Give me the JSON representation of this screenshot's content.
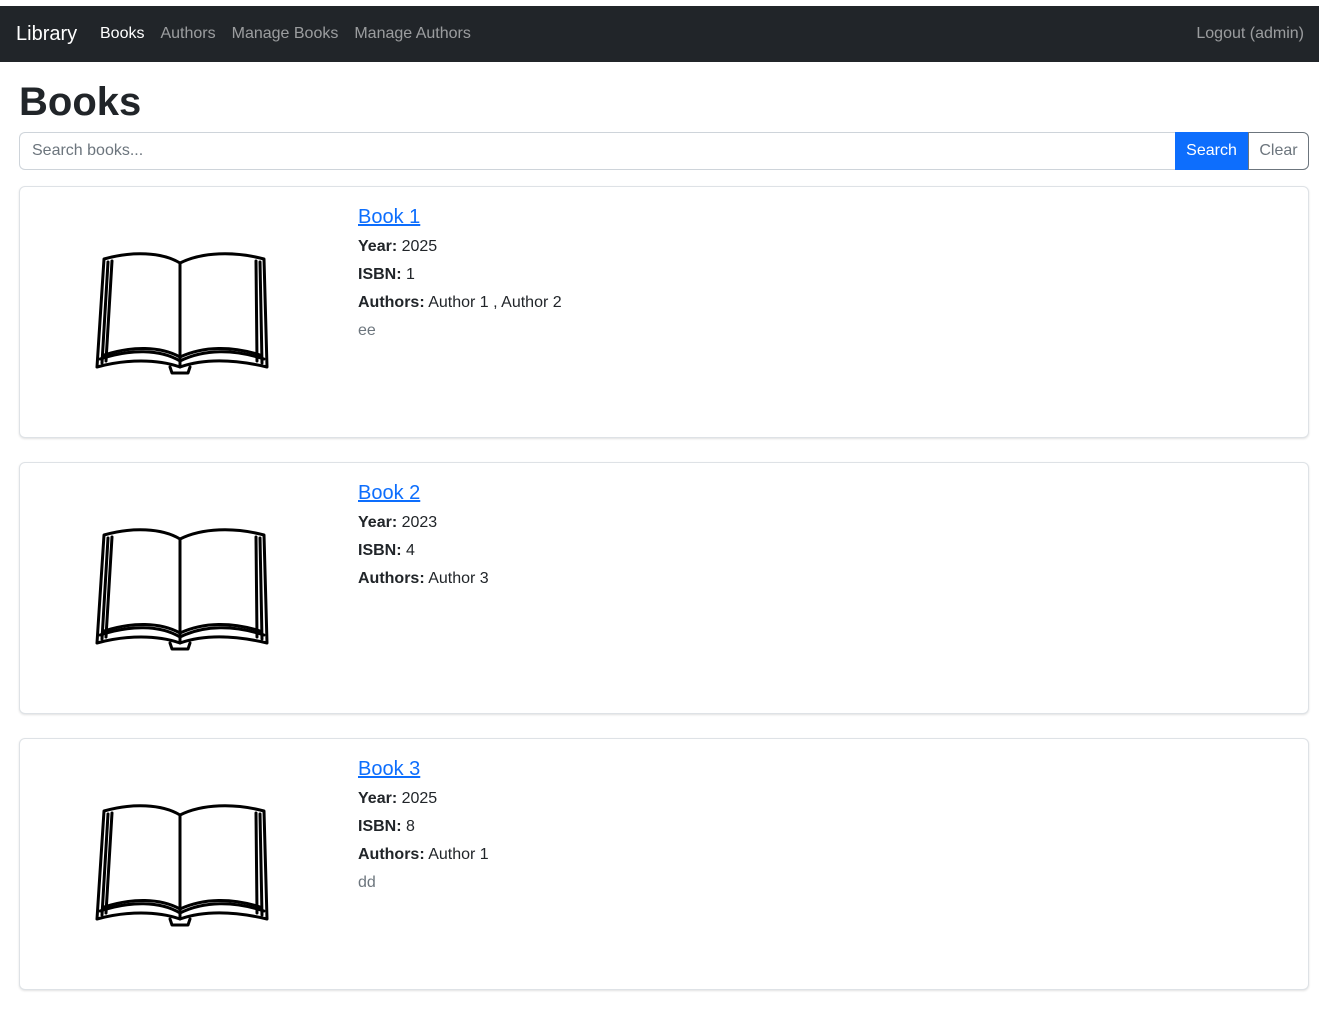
{
  "navbar": {
    "brand": "Library",
    "links": [
      {
        "label": "Books",
        "active": true
      },
      {
        "label": "Authors"
      },
      {
        "label": "Manage Books"
      },
      {
        "label": "Manage Authors"
      }
    ],
    "logout": "Logout (admin)"
  },
  "page": {
    "title": "Books"
  },
  "search": {
    "placeholder": "Search books...",
    "value": "",
    "search_label": "Search",
    "clear_label": "Clear"
  },
  "labels": {
    "year": "Year:",
    "isbn": "ISBN:",
    "authors": "Authors:"
  },
  "books": [
    {
      "title": "Book 1",
      "year": "2025",
      "isbn": "1",
      "authors": "Author 1 , Author 2",
      "description": "ee"
    },
    {
      "title": "Book 2",
      "year": "2023",
      "isbn": "4",
      "authors": "Author 3",
      "description": ""
    },
    {
      "title": "Book 3",
      "year": "2025",
      "isbn": "8",
      "authors": "Author 1",
      "description": "dd"
    }
  ],
  "colors": {
    "navbar_bg": "#212529",
    "primary": "#0d6efd",
    "secondary": "#6c757d"
  },
  "icons": {
    "cover": "open-book-icon"
  }
}
